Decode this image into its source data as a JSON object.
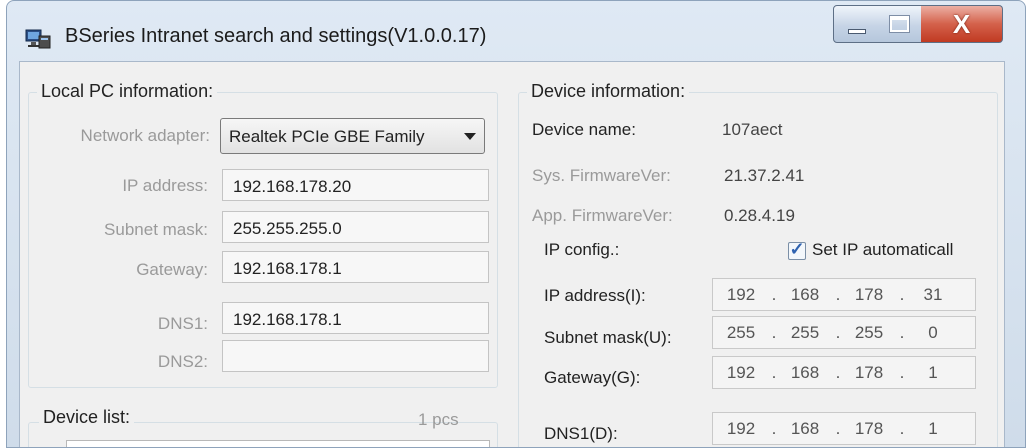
{
  "window": {
    "title": "BSeries Intranet search and settings(V1.0.0.17)",
    "icon": "network-computer-icon",
    "controls": {
      "minimize": "minimize-icon",
      "maximize": "maximize-icon",
      "close": "X"
    }
  },
  "local_pc": {
    "group_title": "Local PC information:",
    "network_adapter_label": "Network adapter:",
    "network_adapter_value": "Realtek PCIe GBE Family",
    "ip_label": "IP address:",
    "ip_value": "192.168.178.20",
    "subnet_label": "Subnet mask:",
    "subnet_value": "255.255.255.0",
    "gateway_label": "Gateway:",
    "gateway_value": "192.168.178.1",
    "dns1_label": "DNS1:",
    "dns1_value": "192.168.178.1",
    "dns2_label": "DNS2:",
    "dns2_value": ""
  },
  "device_list": {
    "group_title": "Device list:",
    "count": "1 pcs"
  },
  "device_info": {
    "group_title": "Device information:",
    "name_label": "Device name:",
    "name_value": "107aect",
    "sys_fw_label": "Sys. FirmwareVer:",
    "sys_fw_value": "21.37.2.41",
    "app_fw_label": "App. FirmwareVer:",
    "app_fw_value": "0.28.4.19",
    "ip_config_label": "IP config.:",
    "auto_ip_label": "Set IP automaticall",
    "auto_ip_checked": true,
    "ip_label": "IP address(I):",
    "ip": [
      "192",
      "168",
      "178",
      "31"
    ],
    "subnet_label": "Subnet mask(U):",
    "subnet": [
      "255",
      "255",
      "255",
      "0"
    ],
    "gateway_label": "Gateway(G):",
    "gateway": [
      "192",
      "168",
      "178",
      "1"
    ],
    "dns1_label": "DNS1(D):",
    "dns1": [
      "192",
      "168",
      "178",
      "1"
    ]
  }
}
